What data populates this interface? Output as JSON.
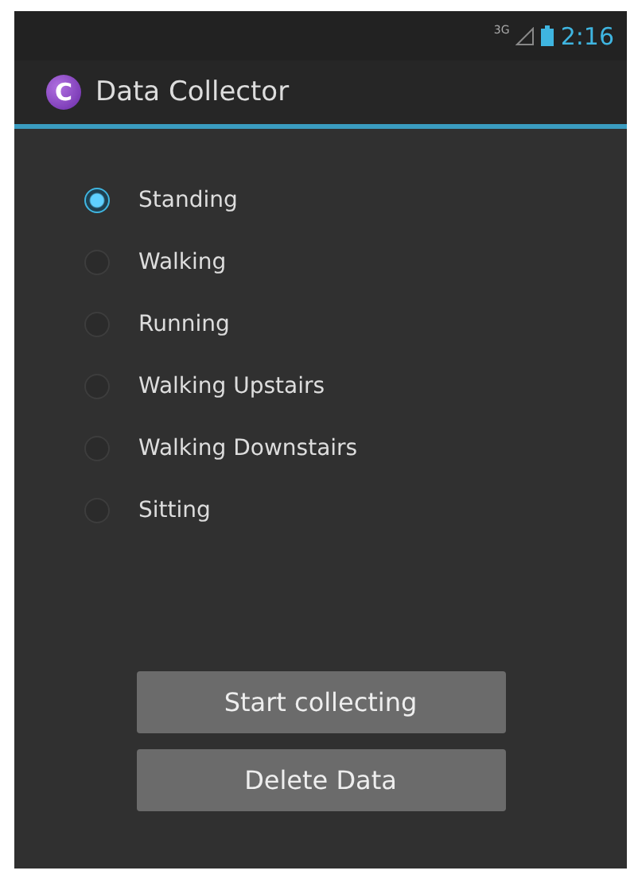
{
  "status_bar": {
    "network": "3G",
    "time": "2:16"
  },
  "action_bar": {
    "logo_letter": "C",
    "title": "Data Collector"
  },
  "activities": [
    {
      "label": "Standing",
      "selected": true
    },
    {
      "label": "Walking",
      "selected": false
    },
    {
      "label": "Running",
      "selected": false
    },
    {
      "label": "Walking Upstairs",
      "selected": false
    },
    {
      "label": "Walking Downstairs",
      "selected": false
    },
    {
      "label": "Sitting",
      "selected": false
    }
  ],
  "buttons": [
    "Start collecting",
    "Delete Data"
  ]
}
